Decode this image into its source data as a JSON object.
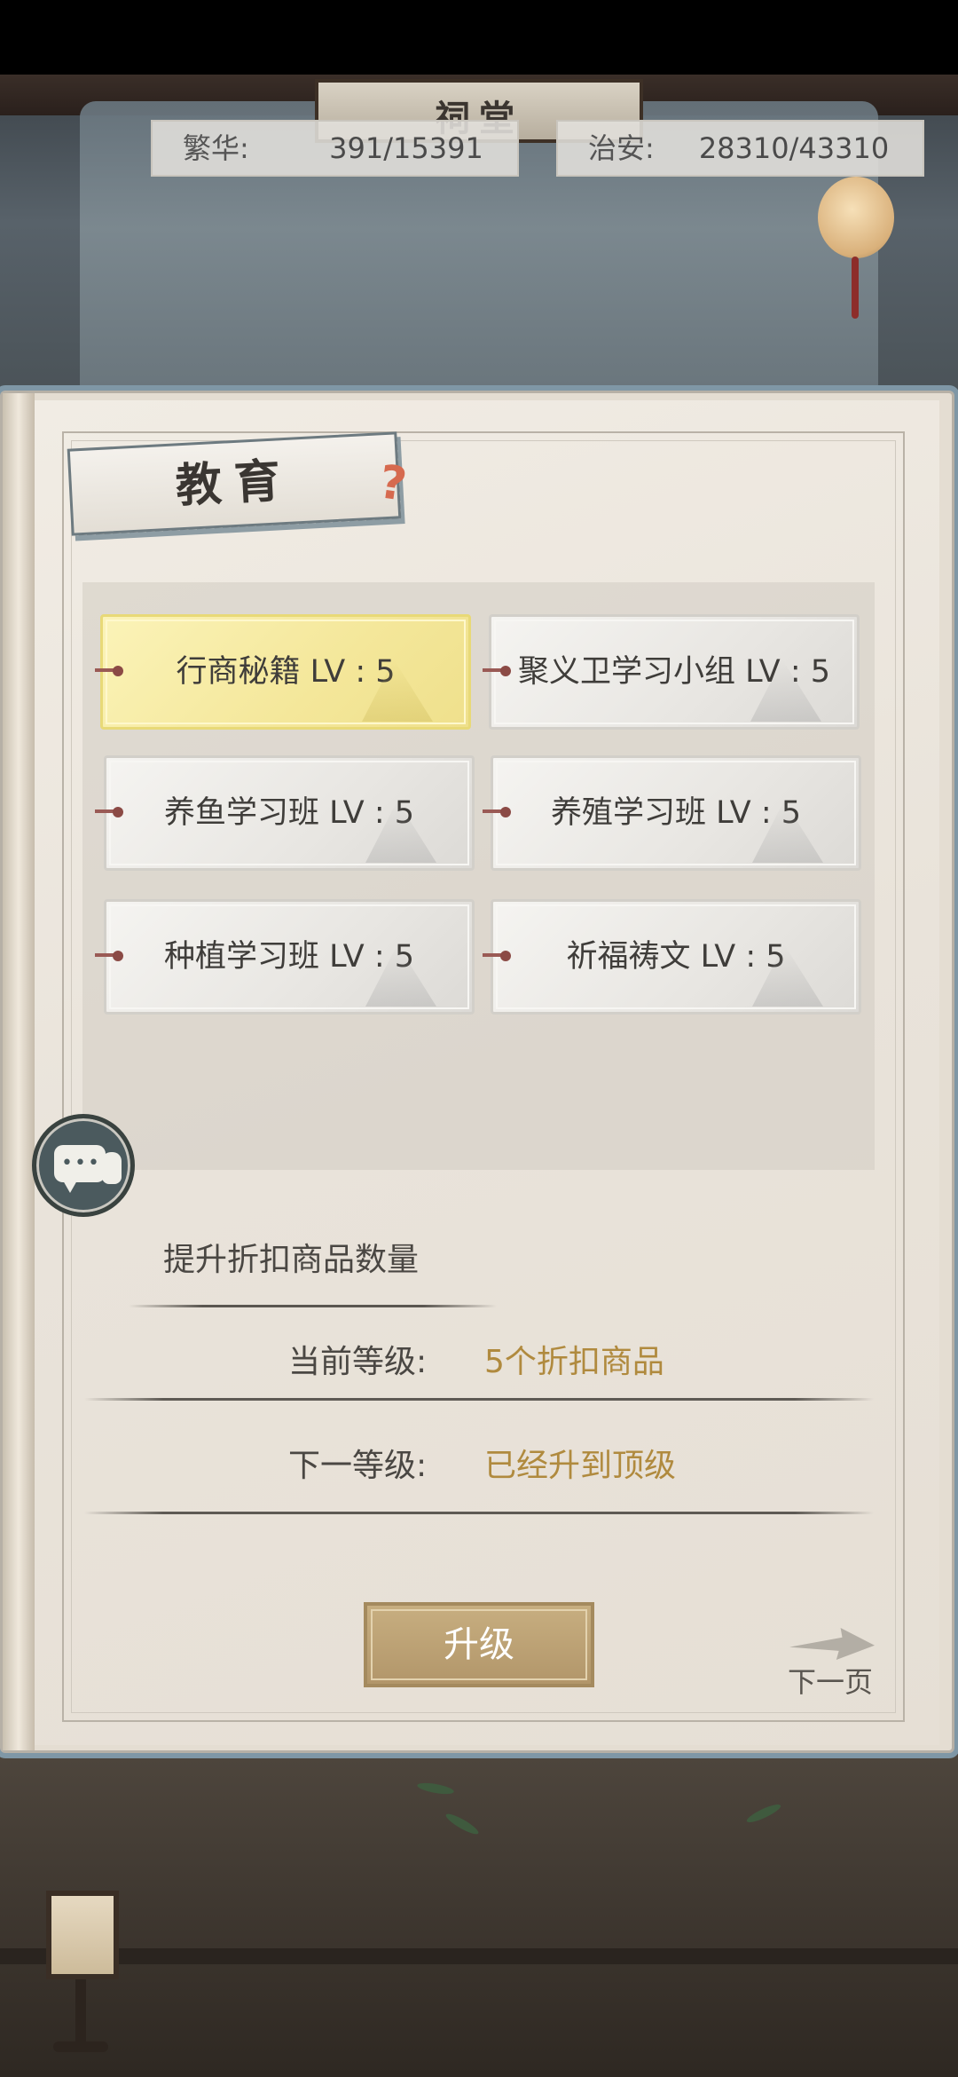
{
  "hud": {
    "prosperity_label": "繁华:",
    "prosperity_value": "391/15391",
    "security_label": "治安:",
    "security_value": "28310/43310"
  },
  "panel": {
    "title": "教育",
    "help_icon": "question-mark-icon",
    "skills": [
      {
        "label": "行商秘籍 LV : 5",
        "selected": true
      },
      {
        "label": "聚义卫学习小组 LV : 5",
        "selected": false
      },
      {
        "label": "养鱼学习班 LV : 5",
        "selected": false
      },
      {
        "label": "养殖学习班 LV : 5",
        "selected": false
      },
      {
        "label": "种植学习班 LV : 5",
        "selected": false
      },
      {
        "label": "祈福祷文 LV : 5",
        "selected": false
      }
    ],
    "description": "提升折扣商品数量",
    "current_label": "当前等级:",
    "current_value": "5个折扣商品",
    "next_label": "下一等级:",
    "next_value": "已经升到顶级",
    "upgrade_button": "升级",
    "next_page": "下一页"
  },
  "colors": {
    "accent_value": "#b08a3e",
    "selected_card": "#f4e79a",
    "button": "#b8a070"
  }
}
